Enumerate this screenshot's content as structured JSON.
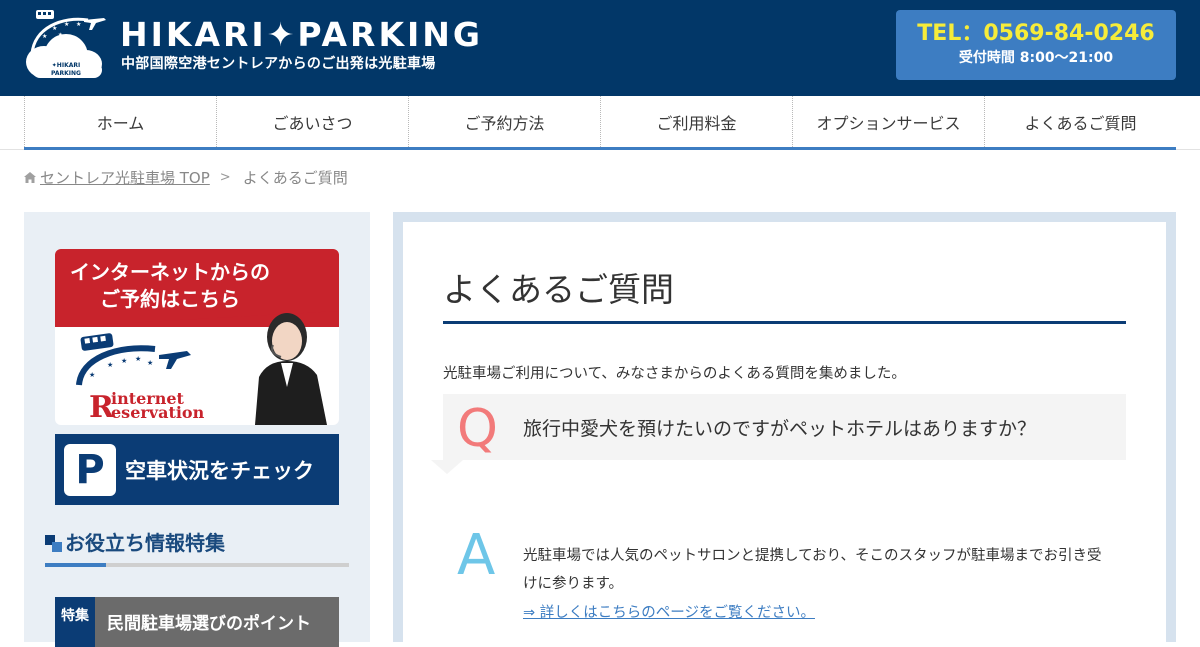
{
  "header": {
    "logo_badge_text": "HIKARI PARKING",
    "brand_name": "HIKARI✦PARKING",
    "tagline": "中部国際空港セントレアからのご出発は光駐車場",
    "tel": "TEL：0569-84-0246",
    "hours": "受付時間 8:00〜21:00"
  },
  "nav": {
    "items": [
      {
        "label": "ホーム"
      },
      {
        "label": "ごあいさつ"
      },
      {
        "label": "ご予約方法"
      },
      {
        "label": "ご利用料金"
      },
      {
        "label": "オプションサービス"
      },
      {
        "label": "よくあるご質問"
      }
    ]
  },
  "breadcrumb": {
    "home_link": "セントレア光駐車場 TOP",
    "separator": ">",
    "current": "よくあるご質問"
  },
  "sidebar": {
    "reserve_banner": {
      "text_line1": "インターネットからの",
      "text_line2": "ご予約はこちら",
      "en_line1": "internet",
      "en_line2": "eservation",
      "en_initial": "R"
    },
    "parking_banner": {
      "icon_letter": "P",
      "text": "空車状況をチェック"
    },
    "section_heading": "お役立ち情報特集",
    "feature_banner": {
      "tag": "特集",
      "text": "民間駐車場選びのポイント"
    }
  },
  "main": {
    "page_title": "よくあるご質問",
    "intro": "光駐車場ご利用について、みなさまからのよくある質問を集めました。",
    "faq": [
      {
        "q_letter": "Q",
        "question": "旅行中愛犬を預けたいのですがペットホテルはありますか？",
        "a_letter": "A",
        "answer": "光駐車場では人気のペットサロンと提携しており、そこのスタッフが駐車場までお引き受けに参ります。",
        "link": "⇒ 詳しくはこちらのページをご覧ください。"
      }
    ]
  },
  "colors": {
    "header_bg": "#023768",
    "tel_box": "#3d7dc2",
    "tel_text": "#f6ec3a",
    "accent_blue": "#3d7dc2",
    "q_color": "#f27a7a",
    "a_color": "#6ec6e8",
    "banner_red": "#c8232c"
  }
}
